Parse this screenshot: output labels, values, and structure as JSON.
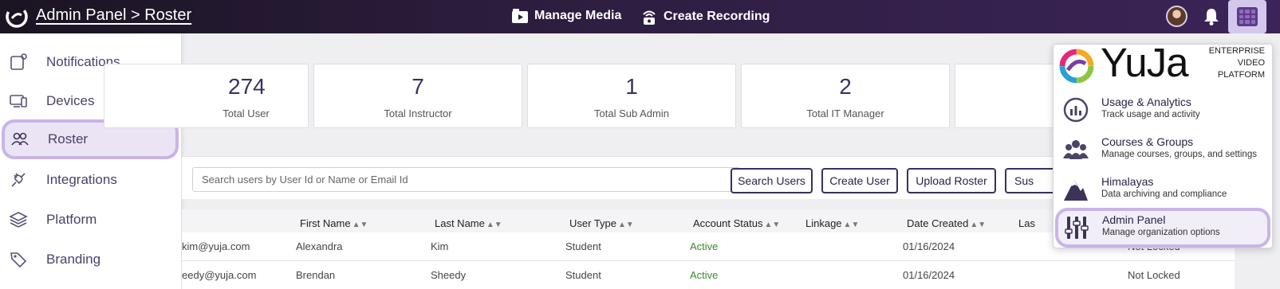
{
  "header": {
    "title": "Admin Panel > Roster",
    "manage_media": "Manage Media",
    "create_recording": "Create Recording"
  },
  "sidebar": {
    "items": [
      {
        "label": "Notifications",
        "icon": "notification-icon"
      },
      {
        "label": "Devices",
        "icon": "devices-icon"
      },
      {
        "label": "Roster",
        "icon": "users-icon",
        "active": true
      },
      {
        "label": "Integrations",
        "icon": "plug-icon"
      },
      {
        "label": "Platform",
        "icon": "layers-icon"
      },
      {
        "label": "Branding",
        "icon": "tag-icon"
      }
    ]
  },
  "stats": [
    {
      "value": "274",
      "label": "Total User"
    },
    {
      "value": "7",
      "label": "Total Instructor"
    },
    {
      "value": "1",
      "label": "Total Sub Admin"
    },
    {
      "value": "2",
      "label": "Total IT Manager"
    }
  ],
  "search": {
    "placeholder": "Search users by User Id or Name or Email Id",
    "buttons": {
      "search": "Search Users",
      "create": "Create User",
      "upload": "Upload Roster",
      "partial": "Sus"
    }
  },
  "table": {
    "columns": [
      "First Name",
      "Last Name",
      "User Type",
      "Account Status",
      "Linkage",
      "Date Created",
      "Las"
    ],
    "rows": [
      {
        "email": "kim@yuja.com",
        "first": "Alexandra",
        "last": "Kim",
        "type": "Student",
        "status": "Active",
        "created": "01/16/2024",
        "lock": "Not Locked"
      },
      {
        "email": "eedy@yuja.com",
        "first": "Brendan",
        "last": "Sheedy",
        "type": "Student",
        "status": "Active",
        "created": "01/16/2024",
        "lock": "Not Locked"
      }
    ]
  },
  "app_switcher": {
    "brand": "YuJa",
    "tagline": [
      "ENTERPRISE",
      "VIDEO",
      "PLATFORM"
    ],
    "items": [
      {
        "title": "Usage & Analytics",
        "subtitle": "Track usage and activity",
        "icon": "analytics-icon"
      },
      {
        "title": "Courses & Groups",
        "subtitle": "Manage courses, groups, and settings",
        "icon": "groups-icon"
      },
      {
        "title": "Himalayas",
        "subtitle": "Data archiving and compliance",
        "icon": "mountain-icon"
      },
      {
        "title": "Admin Panel",
        "subtitle": "Manage organization options",
        "icon": "sliders-icon",
        "active": true
      }
    ]
  },
  "colors": {
    "topbar": "#2c1d3e",
    "accent": "#c9b4e6",
    "active_status": "#3a8a2e",
    "text_primary": "#3b3063"
  }
}
